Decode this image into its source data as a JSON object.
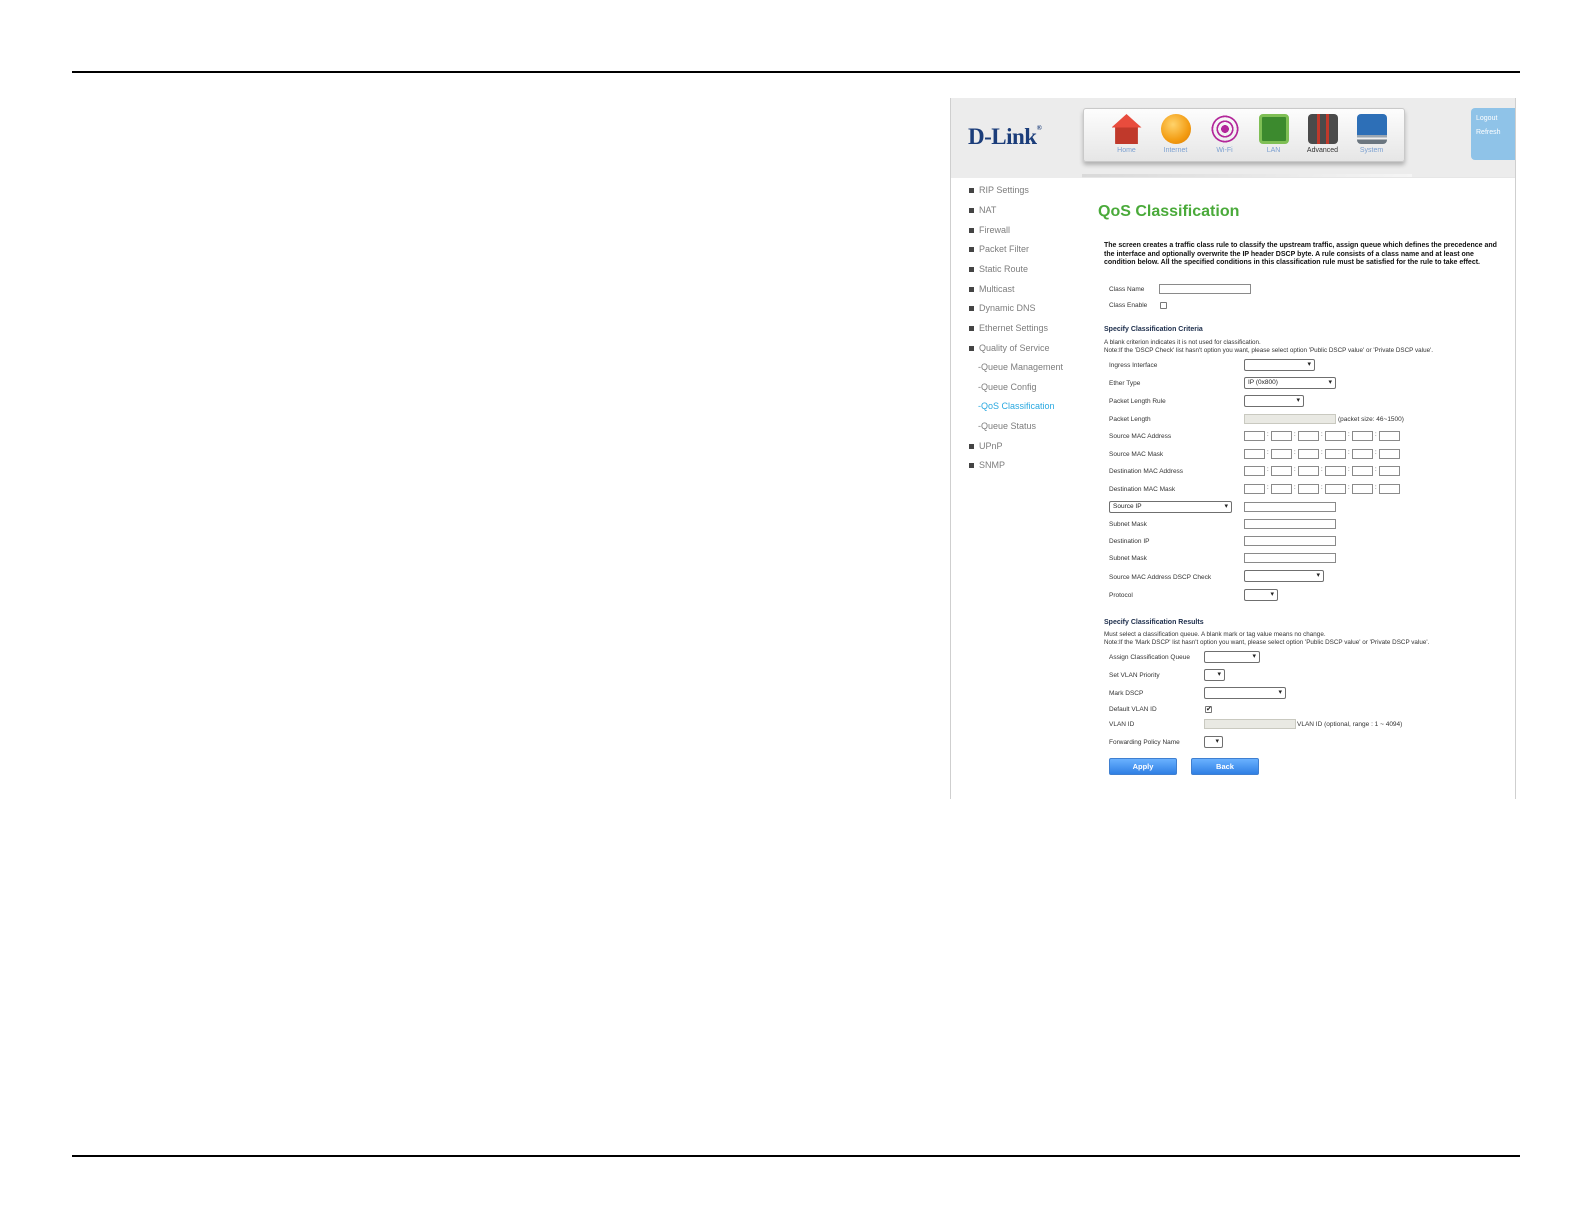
{
  "brand": {
    "logo": "D-Link",
    "registered": "®"
  },
  "nav": [
    {
      "label": "Home",
      "icon": "home-icon"
    },
    {
      "label": "Internet",
      "icon": "globe-icon"
    },
    {
      "label": "Wi-Fi",
      "icon": "wifi-icon"
    },
    {
      "label": "LAN",
      "icon": "lan-icon"
    },
    {
      "label": "Advanced",
      "icon": "tools-icon"
    },
    {
      "label": "System",
      "icon": "monitor-icon"
    }
  ],
  "header_links": {
    "logout": "Logout",
    "refresh": "Refresh"
  },
  "sidebar": [
    "RIP Settings",
    "NAT",
    "Firewall",
    "Packet Filter",
    "Static Route",
    "Multicast",
    "Dynamic DNS",
    "Ethernet Settings",
    "Quality of Service",
    "-Queue Management",
    "-Queue Config",
    "-QoS Classification",
    "-Queue Status",
    "UPnP",
    "SNMP"
  ],
  "page": {
    "title": "QoS Classification",
    "intro": "The screen creates a traffic class rule to classify the upstream traffic, assign queue which defines the precedence and the interface and optionally overwrite the IP header DSCP byte. A rule consists of a class name and at least one condition below. All the specified conditions in this classification rule must be satisfied for the rule to take effect."
  },
  "class": {
    "name_label": "Class Name",
    "name_value": "",
    "enable_label": "Class Enable"
  },
  "criteria": {
    "heading": "Specify Classification Criteria",
    "note1": "A blank criterion indicates it is not used for classification.",
    "note2": "Note:If the 'DSCP Check' list hasn't option you want, please select option 'Public DSCP value' or 'Private DSCP value'.",
    "ingress_label": "Ingress Interface",
    "ingress_value": "",
    "ether_label": "Ether Type",
    "ether_value": "IP (0x800)",
    "pkt_rule_label": "Packet Length Rule",
    "pkt_rule_value": "",
    "pkt_len_label": "Packet Length",
    "pkt_len_hint": "(packet size: 46~1500)",
    "src_mac_label": "Source MAC Address",
    "src_mask_label": "Source MAC Mask",
    "dst_mac_label": "Destination MAC Address",
    "dst_mask_label": "Destination MAC Mask",
    "ip_type_value": "Source IP",
    "subnet1_label": "Subnet Mask",
    "dst_ip_label": "Destination IP",
    "subnet2_label": "Subnet Mask",
    "dscp_check_label": "Source MAC Address DSCP Check",
    "dscp_check_value": "",
    "protocol_label": "Protocol",
    "protocol_value": "",
    "mac_sep": ":"
  },
  "results": {
    "heading": "Specify Classification Results",
    "note1": "Must select a classification queue. A blank mark or tag value means no change.",
    "note2": "Note:If the 'Mark DSCP' list hasn't option you want, please select option 'Public DSCP value' or 'Private DSCP value'.",
    "queue_label": "Assign Classification Queue",
    "queue_value": "",
    "vlan_pri_label": "Set VLAN Priority",
    "vlan_pri_value": "",
    "mark_dscp_label": "Mark DSCP",
    "mark_dscp_value": "",
    "default_vlan_label": "Default VLAN ID",
    "default_vlan_checked": "✔",
    "vlan_id_label": "VLAN ID",
    "vlan_id_hint": "VLAN ID (optional, range : 1 ~ 4094)",
    "fwd_label": "Forwarding Policy Name",
    "fwd_value": ""
  },
  "buttons": {
    "apply": "Apply",
    "back": "Back"
  }
}
